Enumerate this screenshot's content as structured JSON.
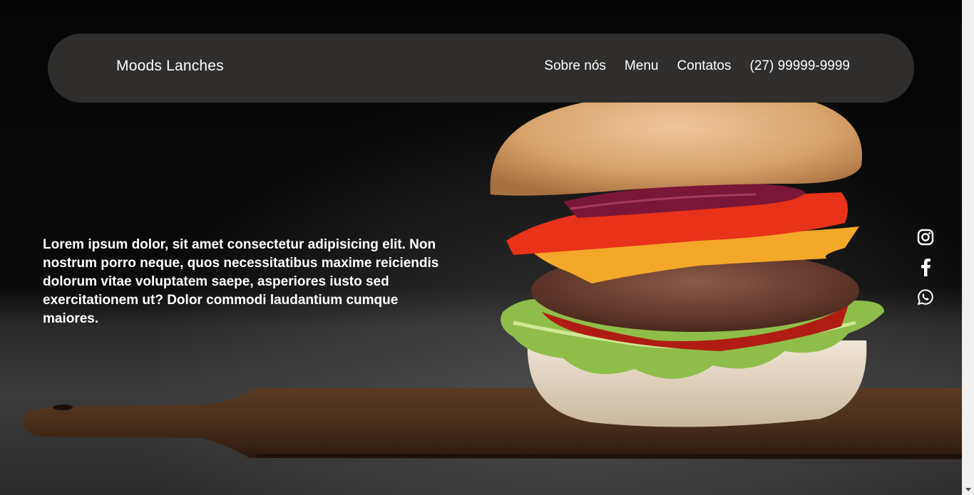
{
  "header": {
    "brand": "Moods Lanches",
    "nav": [
      {
        "label": "Sobre nós"
      },
      {
        "label": "Menu"
      },
      {
        "label": "Contatos"
      },
      {
        "label": "(27) 99999-9999"
      }
    ]
  },
  "hero": {
    "text": "Lorem ipsum dolor, sit amet consectetur adipisicing elit. Non nostrum porro neque, quos necessitatibus maxime reiciendis dolorum vitae voluptatem saepe, asperiores iusto sed exercitationem ut? Dolor commodi laudantium cumque maiores."
  },
  "social": [
    {
      "icon": "instagram-icon"
    },
    {
      "icon": "facebook-icon"
    },
    {
      "icon": "whatsapp-icon"
    }
  ],
  "colors": {
    "header_bg": "#2f2e2c",
    "text": "#ffffff",
    "page_bg": "#000000"
  }
}
